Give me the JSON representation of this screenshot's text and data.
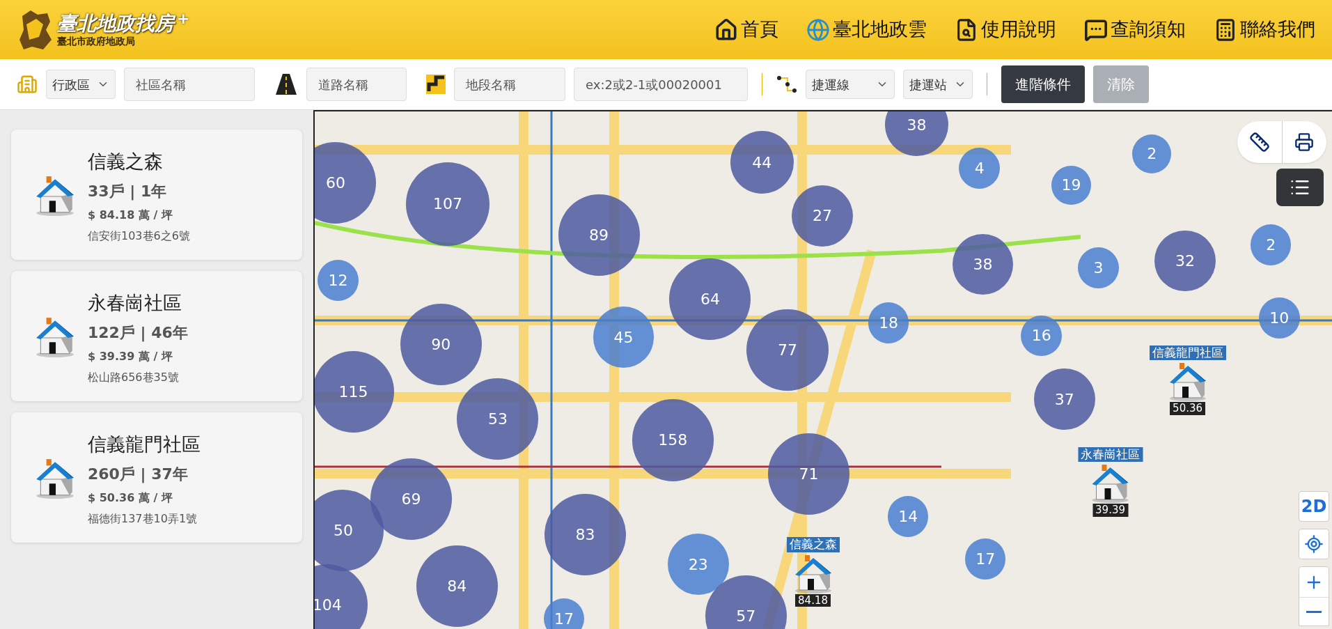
{
  "header": {
    "logo_title": "臺北地政找房",
    "logo_plus": "+",
    "logo_subtitle": "臺北市政府地政局",
    "nav": [
      {
        "label": "首頁",
        "kind": "home"
      },
      {
        "label": "臺北地政雲",
        "kind": "globe"
      },
      {
        "label": "使用說明",
        "kind": "guide"
      },
      {
        "label": "查詢須知",
        "kind": "notice"
      },
      {
        "label": "聯絡我們",
        "kind": "contact"
      }
    ]
  },
  "filters": {
    "district": {
      "value": "行政區"
    },
    "community": {
      "placeholder": "社區名稱"
    },
    "road": {
      "placeholder": "道路名稱"
    },
    "section": {
      "placeholder": "地段名稱"
    },
    "lot": {
      "placeholder": "ex:2或2-1或00020001"
    },
    "mrt_line": {
      "value": "捷運線"
    },
    "mrt_station": {
      "value": "捷運站"
    },
    "buttons": [
      {
        "label": "進階條件",
        "disabled": false
      },
      {
        "label": "清除",
        "disabled": true
      }
    ]
  },
  "listings": [
    {
      "name": "信義之森",
      "units_age": "33戶 | 1年",
      "price": "$ 84.18 萬 / 坪",
      "address": "信安街103巷6之6號"
    },
    {
      "name": "永春崗社區",
      "units_age": "122戶 | 46年",
      "price": "$ 39.39 萬 / 坪",
      "address": "松山路656巷35號"
    },
    {
      "name": "信義龍門社區",
      "units_age": "260戶 | 37年",
      "price": "$ 50.36 萬 / 坪",
      "address": "福德街137巷10弄1號"
    }
  ],
  "map": {
    "clusters": [
      {
        "count": "60",
        "kind": "large"
      },
      {
        "count": "107",
        "kind": "large"
      },
      {
        "count": "89",
        "kind": "large"
      },
      {
        "count": "44",
        "kind": "large"
      },
      {
        "count": "38",
        "kind": "large"
      },
      {
        "count": "4",
        "kind": "small"
      },
      {
        "count": "19",
        "kind": "small"
      },
      {
        "count": "2",
        "kind": "small"
      },
      {
        "count": "27",
        "kind": "large"
      },
      {
        "count": "12",
        "kind": "small"
      },
      {
        "count": "38",
        "kind": "large"
      },
      {
        "count": "3",
        "kind": "small"
      },
      {
        "count": "32",
        "kind": "large"
      },
      {
        "count": "2",
        "kind": "small"
      },
      {
        "count": "64",
        "kind": "large"
      },
      {
        "count": "90",
        "kind": "large"
      },
      {
        "count": "45",
        "kind": "small"
      },
      {
        "count": "77",
        "kind": "large"
      },
      {
        "count": "18",
        "kind": "small"
      },
      {
        "count": "16",
        "kind": "small"
      },
      {
        "count": "10",
        "kind": "small"
      },
      {
        "count": "115",
        "kind": "large"
      },
      {
        "count": "53",
        "kind": "large"
      },
      {
        "count": "158",
        "kind": "large"
      },
      {
        "count": "37",
        "kind": "large"
      },
      {
        "count": "71",
        "kind": "large"
      },
      {
        "count": "69",
        "kind": "large"
      },
      {
        "count": "50",
        "kind": "large"
      },
      {
        "count": "83",
        "kind": "large"
      },
      {
        "count": "14",
        "kind": "small"
      },
      {
        "count": "23",
        "kind": "small"
      },
      {
        "count": "17",
        "kind": "small"
      },
      {
        "count": "84",
        "kind": "large"
      },
      {
        "count": "104",
        "kind": "large"
      },
      {
        "count": "57",
        "kind": "large"
      },
      {
        "count": "17",
        "kind": "small"
      }
    ],
    "markers": [
      {
        "name": "信義龍門社區",
        "price": "50.36"
      },
      {
        "name": "永春崗社區",
        "price": "39.39"
      },
      {
        "name": "信義之森",
        "price": "84.18"
      }
    ],
    "view_mode": "2D"
  }
}
